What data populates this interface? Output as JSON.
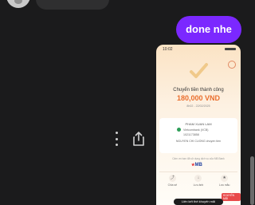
{
  "chat": {
    "outgoing_message": "done nhe"
  },
  "receipt": {
    "status_time": "10:02",
    "title": "Chuyển tiền thành công",
    "amount": "180,000 VND",
    "datetime": "8h02 - 22/02/2025",
    "recipient_name": "PHAM XUAN LAM",
    "bank": "Vietcombank (VCB)",
    "account_number": "1021173858",
    "message": "NGUYEN CHI CUONG chuyen tien",
    "note": "Cảm ơn bạn đã sử dụng dịch vụ của MB Bank",
    "bank_logo": "MB",
    "actions": [
      {
        "label": "Chia sẻ",
        "icon": "share-icon"
      },
      {
        "label": "Lưu ảnh",
        "icon": "download-icon"
      },
      {
        "label": "Lưu mẫu",
        "icon": "save-template-icon"
      }
    ],
    "promo_badge": "KHUYẾN MÃI",
    "bottom_button": "Liên kết thẻ khuyến mãi"
  },
  "colors": {
    "outgoing_bubble": "#7b28ff",
    "amount": "#ea6e2d",
    "background": "#1b1b1c"
  }
}
